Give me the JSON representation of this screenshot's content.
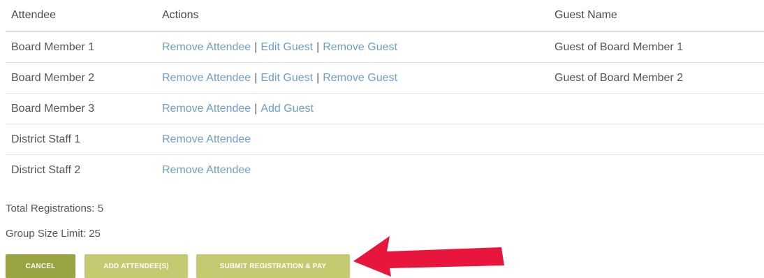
{
  "table": {
    "headers": {
      "attendee": "Attendee",
      "actions": "Actions",
      "guest_name": "Guest Name"
    },
    "rows": [
      {
        "attendee": "Board Member 1",
        "actions": [
          "Remove Attendee",
          "Edit Guest",
          "Remove Guest"
        ],
        "guest_name": "Guest of Board Member 1"
      },
      {
        "attendee": "Board Member 2",
        "actions": [
          "Remove Attendee",
          "Edit Guest",
          "Remove Guest"
        ],
        "guest_name": "Guest of Board Member 2"
      },
      {
        "attendee": "Board Member 3",
        "actions": [
          "Remove Attendee",
          "Add Guest"
        ],
        "guest_name": ""
      },
      {
        "attendee": "District Staff 1",
        "actions": [
          "Remove Attendee"
        ],
        "guest_name": ""
      },
      {
        "attendee": "District Staff 2",
        "actions": [
          "Remove Attendee"
        ],
        "guest_name": ""
      }
    ],
    "separator": "|"
  },
  "summary": {
    "total_registrations": "Total Registrations: 5",
    "group_size_limit": "Group Size Limit: 25"
  },
  "buttons": {
    "cancel": "CANCEL",
    "add_attendees": "ADD ATTENDEE(S)",
    "submit": "SUBMIT REGISTRATION & PAY"
  },
  "colors": {
    "link": "#6e9ec6",
    "cancel_button": "#9aa342",
    "secondary_button": "#c5c96f",
    "arrow": "#e8163c"
  },
  "annotation": {
    "icon": "arrow-left-icon"
  }
}
